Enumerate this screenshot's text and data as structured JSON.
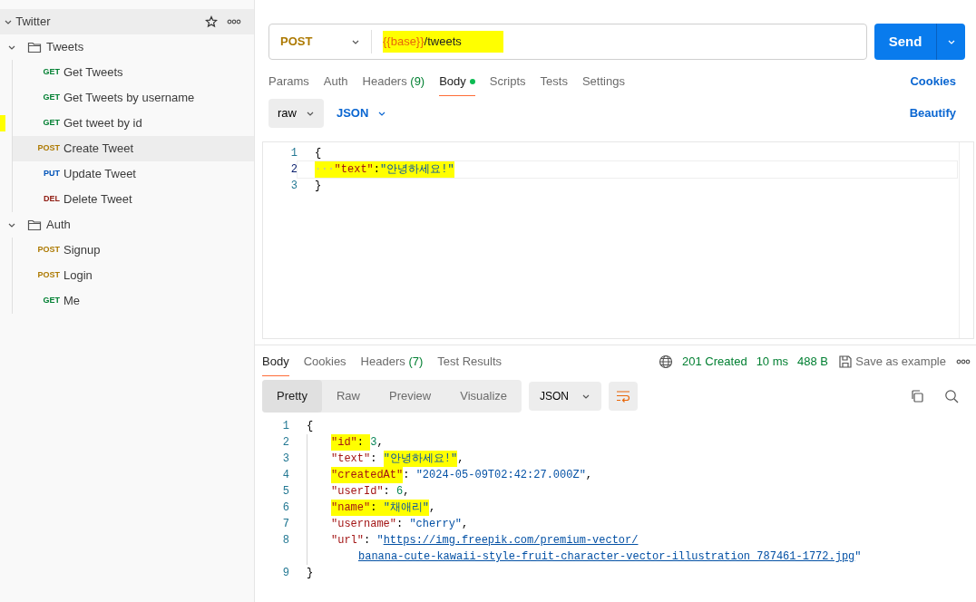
{
  "sidebar": {
    "collection": {
      "name": "Twitter",
      "expanded": true,
      "folders": [
        {
          "name": "Tweets",
          "expanded": true,
          "children": [
            {
              "method": "GET",
              "name": "Get Tweets",
              "selected": false
            },
            {
              "method": "GET",
              "name": "Get Tweets by username",
              "selected": false
            },
            {
              "method": "GET",
              "name": "Get tweet by id",
              "selected": false,
              "highlight": true
            },
            {
              "method": "POST",
              "name": "Create Tweet",
              "selected": true
            },
            {
              "method": "PUT",
              "name": "Update Tweet",
              "selected": false
            },
            {
              "method": "DEL",
              "name": "Delete Tweet",
              "selected": false
            }
          ]
        },
        {
          "name": "Auth",
          "expanded": true,
          "children": [
            {
              "method": "POST",
              "name": "Signup",
              "selected": false
            },
            {
              "method": "POST",
              "name": "Login",
              "selected": false
            },
            {
              "method": "GET",
              "name": "Me",
              "selected": false
            }
          ]
        }
      ]
    }
  },
  "request": {
    "method": "POST",
    "url_variable": "{{base}}",
    "url_path": "/tweets",
    "url_highlight": true,
    "send": "Send"
  },
  "request_tabs": [
    {
      "label": "Params",
      "selected": false
    },
    {
      "label": "Auth",
      "selected": false
    },
    {
      "label": "Headers",
      "count": "(9)",
      "selected": false
    },
    {
      "label": "Body",
      "selected": true,
      "dot": true
    },
    {
      "label": "Scripts",
      "selected": false
    },
    {
      "label": "Tests",
      "selected": false
    },
    {
      "label": "Settings",
      "selected": false
    }
  ],
  "cookies_link": "Cookies",
  "body_mode": "raw",
  "body_language": "JSON",
  "beautify": "Beautify",
  "request_body": [
    {
      "number": "1",
      "active": false,
      "tokens": [
        {
          "kind": "punct",
          "text": "{"
        }
      ]
    },
    {
      "number": "2",
      "active": true,
      "tokens": [
        {
          "kind": "whitespace",
          "text": "···",
          "highlight": true
        },
        {
          "kind": "key",
          "text": "\"text\"",
          "highlight": true
        },
        {
          "kind": "punct",
          "text": ":",
          "highlight": true
        },
        {
          "kind": "string",
          "text": "\"안녕하세요!\"",
          "highlight": true
        }
      ]
    },
    {
      "number": "3",
      "active": false,
      "tokens": [
        {
          "kind": "punct",
          "text": "}"
        }
      ]
    }
  ],
  "response_tabs": [
    {
      "label": "Body",
      "selected": true
    },
    {
      "label": "Cookies",
      "selected": false
    },
    {
      "label": "Headers",
      "count": "(7)",
      "selected": false
    },
    {
      "label": "Test Results",
      "selected": false
    }
  ],
  "response_status": {
    "status": "201 Created",
    "time": "10 ms",
    "size": "488 B",
    "save": "Save as example"
  },
  "view_modes": [
    {
      "label": "Pretty",
      "selected": true
    },
    {
      "label": "Raw",
      "selected": false
    },
    {
      "label": "Preview",
      "selected": false
    },
    {
      "label": "Visualize",
      "selected": false
    }
  ],
  "response_format": "JSON",
  "response_body": [
    {
      "number": "1",
      "indented": false,
      "tokens": [
        {
          "kind": "punct",
          "text": "{"
        }
      ]
    },
    {
      "number": "2",
      "indented": true,
      "tokens": [
        {
          "kind": "key",
          "text": "\"id\"",
          "highlight": true
        },
        {
          "kind": "punct",
          "text": ": ",
          "highlight": true
        },
        {
          "kind": "number",
          "text": "3"
        },
        {
          "kind": "punct",
          "text": ","
        }
      ]
    },
    {
      "number": "3",
      "indented": true,
      "tokens": [
        {
          "kind": "key",
          "text": "\"text\""
        },
        {
          "kind": "punct",
          "text": ": "
        },
        {
          "kind": "string",
          "text": "\"안녕하세요!\"",
          "highlight": true
        },
        {
          "kind": "punct",
          "text": ","
        }
      ]
    },
    {
      "number": "4",
      "indented": true,
      "tokens": [
        {
          "kind": "key",
          "text": "\"createdAt\"",
          "highlight": true
        },
        {
          "kind": "punct",
          "text": ": "
        },
        {
          "kind": "string",
          "text": "\"2024-05-09T02:42:27.000Z\""
        },
        {
          "kind": "punct",
          "text": ","
        }
      ]
    },
    {
      "number": "5",
      "indented": true,
      "tokens": [
        {
          "kind": "key",
          "text": "\"userId\""
        },
        {
          "kind": "punct",
          "text": ": "
        },
        {
          "kind": "number",
          "text": "6"
        },
        {
          "kind": "punct",
          "text": ","
        }
      ]
    },
    {
      "number": "6",
      "indented": true,
      "tokens": [
        {
          "kind": "key",
          "text": "\"name\"",
          "highlight": true
        },
        {
          "kind": "punct",
          "text": ": ",
          "highlight": true
        },
        {
          "kind": "string",
          "text": "\"채애리\"",
          "highlight": true
        },
        {
          "kind": "punct",
          "text": ","
        }
      ]
    },
    {
      "number": "7",
      "indented": true,
      "tokens": [
        {
          "kind": "key",
          "text": "\"username\""
        },
        {
          "kind": "punct",
          "text": ": "
        },
        {
          "kind": "string",
          "text": "\"cherry\""
        },
        {
          "kind": "punct",
          "text": ","
        }
      ]
    },
    {
      "number": "8",
      "indented": true,
      "tokens": [
        {
          "kind": "key",
          "text": "\"url\""
        },
        {
          "kind": "punct",
          "text": ": "
        },
        {
          "kind": "string",
          "text": "\""
        },
        {
          "kind": "link",
          "text": "https://img.freepik.com/premium-vector/"
        }
      ]
    },
    {
      "indented": true,
      "tokens": [
        {
          "kind": "link",
          "text": "banana-cute-kawaii-style-fruit-character-vector-illustration_787461-1772.jpg"
        },
        {
          "kind": "string",
          "text": "\""
        }
      ]
    },
    {
      "number": "9",
      "indented": false,
      "tokens": [
        {
          "kind": "punct",
          "text": "}"
        }
      ]
    }
  ]
}
